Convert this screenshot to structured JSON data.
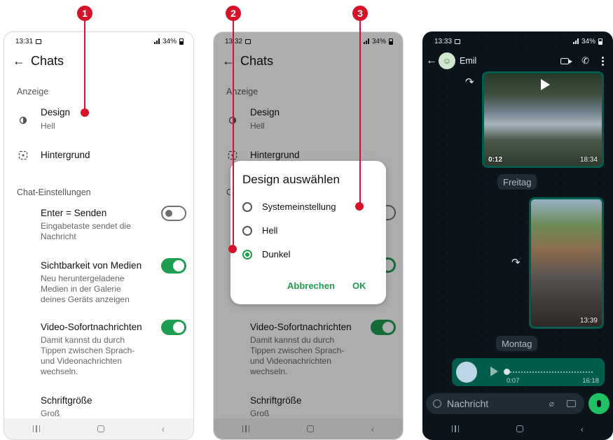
{
  "markers": [
    "1",
    "2",
    "3"
  ],
  "screen1": {
    "status_time": "13:31",
    "status_battery": "34%",
    "back": "←",
    "title": "Chats",
    "section_display": "Anzeige",
    "design_label": "Design",
    "design_value": "Hell",
    "background_label": "Hintergrund",
    "section_chat": "Chat-Einstellungen",
    "enter_label": "Enter = Senden",
    "enter_desc": "Eingabetaste sendet die Nachricht",
    "enter_state": false,
    "media_label": "Sichtbarkeit von Medien",
    "media_desc": "Neu heruntergeladene Medien in der Galerie deines Geräts anzeigen",
    "media_state": true,
    "video_label": "Video-Sofortnachrichten",
    "video_desc": "Damit kannst du durch Tippen zwischen Sprach- und Videonachrichten wechseln.",
    "video_state": true,
    "font_label": "Schriftgröße",
    "font_value": "Groß"
  },
  "screen2": {
    "status_time": "13:32",
    "status_battery": "34%",
    "back": "←",
    "title": "Chats",
    "section_display": "Anzeige",
    "design_label": "Design",
    "design_value": "Hell",
    "background_label": "Hintergrund",
    "section_chat_partial": "C",
    "video_label": "Video-Sofortnachrichten",
    "video_desc": "Damit kannst du durch Tippen zwischen Sprach- und Videonachrichten wechseln.",
    "font_label": "Schriftgröße",
    "font_value": "Groß",
    "dialog": {
      "title": "Design auswählen",
      "options": [
        {
          "label": "Systemeinstellung",
          "selected": false
        },
        {
          "label": "Hell",
          "selected": false
        },
        {
          "label": "Dunkel",
          "selected": true
        }
      ],
      "cancel": "Abbrechen",
      "ok": "OK"
    }
  },
  "screen3": {
    "status_time": "13:33",
    "status_battery": "34%",
    "back": "←",
    "contact": "Emil",
    "video_duration": "0:12",
    "video_time": "18:34",
    "day1": "Freitag",
    "photo_time": "13:39",
    "day2": "Montag",
    "voice_duration": "0:07",
    "voice_time": "16:18",
    "input_placeholder": "Nachricht"
  },
  "colors": {
    "accent_green": "#1e9e50",
    "marker_red": "#d7132a",
    "dark_bg": "#0b141a",
    "bubble_green": "#005c4b"
  }
}
